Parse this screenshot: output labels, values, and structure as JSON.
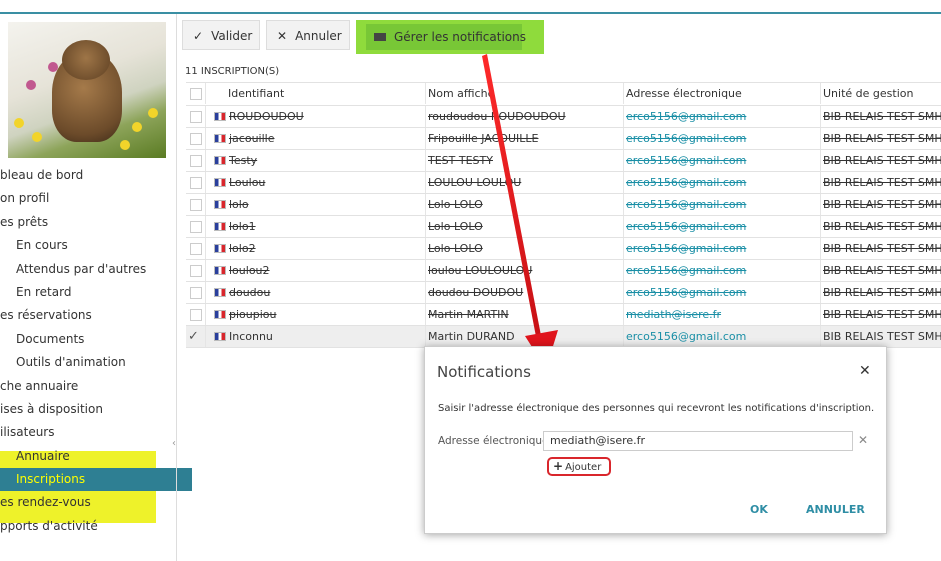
{
  "toolbar": {
    "validate_label": "Valider",
    "cancel_label": "Annuler",
    "notifications_label": "Gérer les notifications"
  },
  "count_label": "11 INSCRIPTION(S)",
  "table": {
    "headers": [
      "Identifiant",
      "Nom affiché",
      "Adresse électronique",
      "Unité de gestion"
    ],
    "rows": [
      {
        "id": "ROUDOUDOU",
        "name": "roudoudou ROUDOUDOU",
        "email": "erco5156@gmail.com",
        "unit": "BIB RELAIS TEST SMH"
      },
      {
        "id": "jacouille",
        "name": "Fripouille JACOUILLE",
        "email": "erco5156@gmail.com",
        "unit": "BIB RELAIS TEST SMH"
      },
      {
        "id": "Testy",
        "name": "TEST TESTY",
        "email": "erco5156@gmail.com",
        "unit": "BIB RELAIS TEST SMH"
      },
      {
        "id": "Loulou",
        "name": "LOULOU LOULOU",
        "email": "erco5156@gmail.com",
        "unit": "BIB RELAIS TEST SMH"
      },
      {
        "id": "lolo",
        "name": "Lolo LOLO",
        "email": "erco5156@gmail.com",
        "unit": "BIB RELAIS TEST SMH"
      },
      {
        "id": "lolo1",
        "name": "Lolo LOLO",
        "email": "erco5156@gmail.com",
        "unit": "BIB RELAIS TEST SMH"
      },
      {
        "id": "lolo2",
        "name": "Lolo LOLO",
        "email": "erco5156@gmail.com",
        "unit": "BIB RELAIS TEST SMH"
      },
      {
        "id": "loulou2",
        "name": "loulou LOULOULOU",
        "email": "erco5156@gmail.com",
        "unit": "BIB RELAIS TEST SMH"
      },
      {
        "id": "doudou",
        "name": "doudou DOUDOU",
        "email": "erco5156@gmail.com",
        "unit": "BIB RELAIS TEST SMH"
      },
      {
        "id": "pioupiou",
        "name": "Martin MARTIN",
        "email": "mediath@isere.fr",
        "unit": "BIB RELAIS TEST SMH"
      },
      {
        "id": "Inconnu",
        "name": "Martin DURAND",
        "email": "erco5156@gmail.com",
        "unit": "BIB RELAIS TEST SMH"
      }
    ]
  },
  "sidebar": {
    "items": [
      "bleau de bord",
      "on profil",
      "es prêts",
      "En cours",
      "Attendus par d'autres",
      "En retard",
      "es réservations",
      "Documents",
      "Outils d'animation",
      "che annuaire",
      "ises à disposition",
      "ilisateurs",
      "Annuaire",
      "Inscriptions",
      "es rendez-vous",
      "pports d'activité"
    ]
  },
  "modal": {
    "title": "Notifications",
    "description": "Saisir l'adresse électronique des personnes qui recevront les notifications d'inscription.",
    "email_label": "Adresse électronique",
    "email_value": "mediath@isere.fr",
    "add_label": "Ajouter",
    "ok_label": "OK",
    "cancel_label": "ANNULER"
  },
  "colors": {
    "accent": "#2f8ea5",
    "highlight_green": "#8fdb3c",
    "highlight_yellow": "#eef22a",
    "annotation_red": "#e0141c"
  }
}
